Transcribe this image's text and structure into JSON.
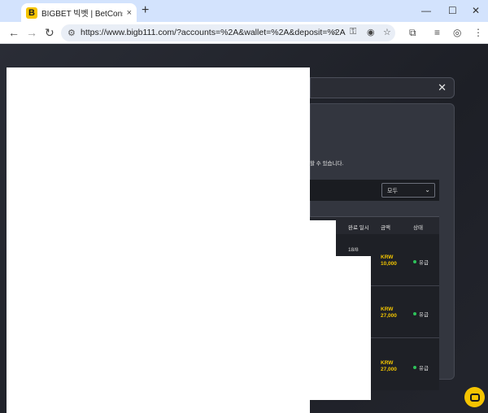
{
  "browser": {
    "tab_title": "BIGBET 빅벳 | BetConstruct 통",
    "favicon_letter": "B",
    "new_tab": "+",
    "tab_close": "×",
    "url": "https://www.bigb111.com/?accounts=%2A&wallet=%2A&deposit=%2A",
    "window_minimize": "—",
    "window_maximize": "☐",
    "window_close": "✕"
  },
  "page": {
    "close_icon": "✕",
    "notice_text": "할 수 있습니다.",
    "filter": {
      "selected": "모두",
      "chevron": "⌄"
    },
    "table": {
      "headers": [
        "완료 일시",
        "금액",
        "상태"
      ],
      "rows": [
        {
          "date": "18/8",
          "currency": "KRW",
          "amount": "10,000",
          "status": "유급"
        },
        {
          "date": "",
          "currency": "KRW",
          "amount": "27,000",
          "status": "유급"
        },
        {
          "date": "",
          "currency": "KRW",
          "amount": "27,000",
          "status": "유급"
        }
      ]
    }
  },
  "colors": {
    "accent": "#f5c400",
    "status_paid": "#2ec35a",
    "background": "#1f2127"
  }
}
